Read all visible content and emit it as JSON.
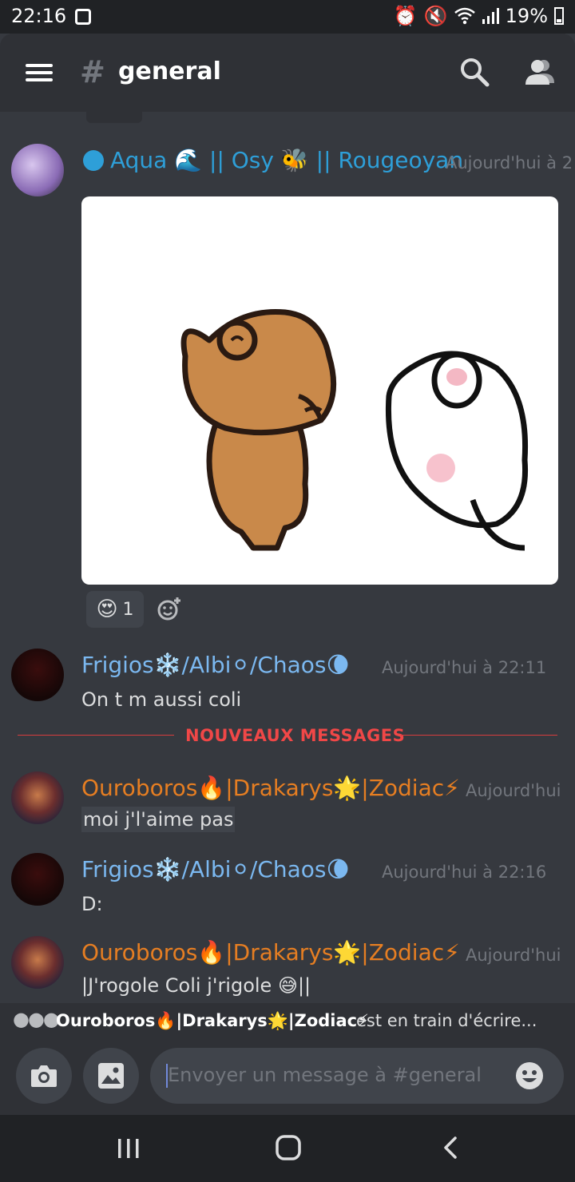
{
  "status_bar": {
    "time": "22:16",
    "battery": "19%"
  },
  "header": {
    "channel_name": "general"
  },
  "messages": [
    {
      "username": "Aqua 🌊 || Osy 🐝 || Rougeoyan",
      "timestamp": "Aujourd'hui à 2",
      "color": "#2e9fd8"
    },
    {
      "username": "Frigios❄️/Albi⚪/Chaos🌘",
      "timestamp": "Aujourd'hui à 22:11",
      "text": "On t m aussi coli",
      "color": "#7bb8f0"
    },
    {
      "username": "Ouroboros🔥|Drakarys🌟|Zodiac⚡",
      "timestamp": "Aujourd'hui",
      "text": "moi j'l'aime pas",
      "color": "#e67e22"
    },
    {
      "username": "Frigios❄️/Albi⚪/Chaos🌘",
      "timestamp": "Aujourd'hui à 22:16",
      "text": "D:",
      "color": "#7bb8f0"
    },
    {
      "username": "Ouroboros🔥|Drakarys🌟|Zodiac⚡",
      "timestamp": "Aujourd'hui",
      "text": "|J'rogole Coli j'rigole 😅||",
      "color": "#e67e22"
    }
  ],
  "reaction": {
    "emoji": "😍",
    "count": "1"
  },
  "new_messages_label": "NOUVEAUX MESSAGES",
  "typing": {
    "user": "Ouroboros🔥|Drakarys🌟|Zodiac⚡",
    "suffix": "est en train d'écrire..."
  },
  "composer": {
    "placeholder": "Envoyer un message à #general"
  },
  "icons": [
    "hamburger-icon",
    "hashtag-icon",
    "search-icon",
    "members-icon",
    "camera-icon",
    "image-icon",
    "emoji-icon",
    "add-reaction-icon",
    "recents-icon",
    "home-icon",
    "back-icon"
  ]
}
